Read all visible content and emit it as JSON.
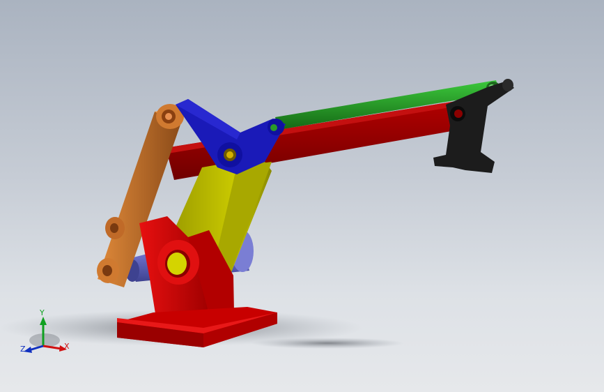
{
  "triad": {
    "x_label": "X",
    "y_label": "Y",
    "z_label": "Z",
    "x_color": "#d01010",
    "y_color": "#10a020",
    "z_color": "#1030c0"
  },
  "parts": {
    "base": {
      "color": "#d40000"
    },
    "bracket": {
      "color": "#d40000"
    },
    "upright_link": {
      "color": "#b8b800"
    },
    "left_link": {
      "color": "#c0702a"
    },
    "triangle_link": {
      "color": "#1010b0"
    },
    "boom": {
      "color": "#a00000"
    },
    "top_rod": {
      "color": "#1f8a1f"
    },
    "end_effector": {
      "color": "#1e1e1e"
    },
    "cylinder": {
      "color": "#6a6ec8"
    }
  }
}
